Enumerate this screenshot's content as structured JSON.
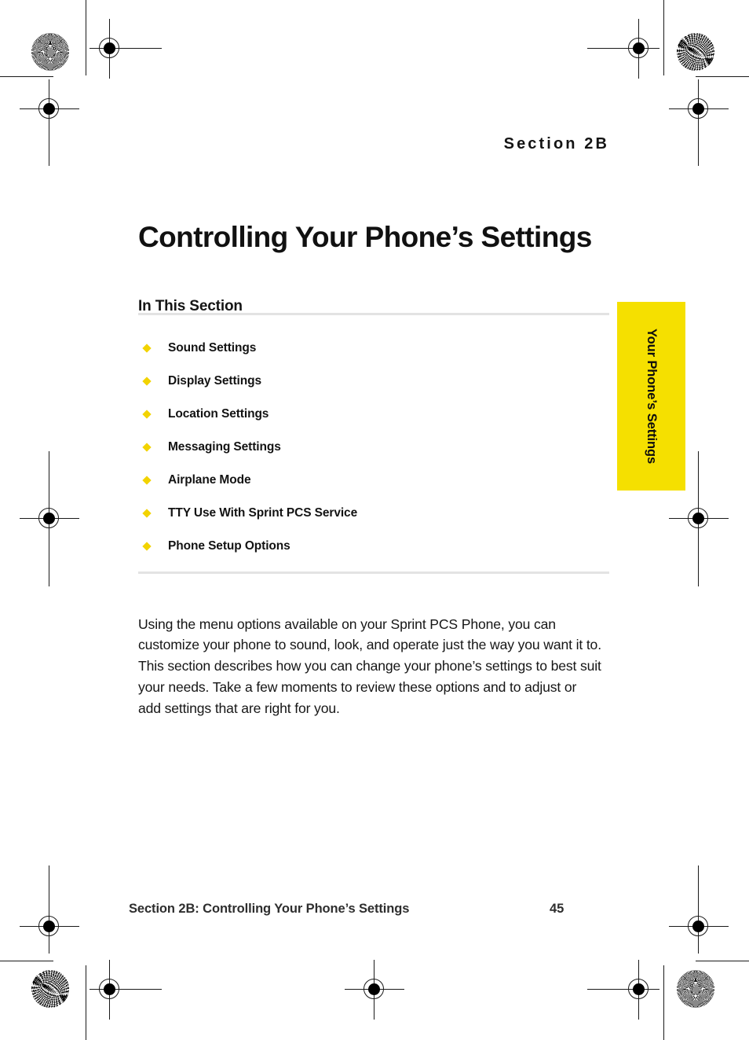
{
  "document": {
    "section_eyebrow": "Section 2B",
    "title": "Controlling Your Phone’s Settings",
    "in_this_section_heading": "In This Section",
    "toc_items": [
      {
        "label": "Sound Settings",
        "bullet": "diamond-bullet-icon"
      },
      {
        "label": "Display Settings",
        "bullet": "diamond-bullet-icon"
      },
      {
        "label": "Location Settings",
        "bullet": "diamond-bullet-icon"
      },
      {
        "label": "Messaging Settings",
        "bullet": "diamond-bullet-icon"
      },
      {
        "label": "Airplane Mode",
        "bullet": "diamond-bullet-icon"
      },
      {
        "label": "TTY Use With Sprint PCS Service",
        "bullet": "diamond-bullet-icon"
      },
      {
        "label": "Phone Setup Options",
        "bullet": "diamond-bullet-icon"
      }
    ],
    "body_paragraph": "Using the menu options available on your Sprint PCS Phone, you can customize your phone to sound, look, and operate just the way you want it to. This section describes how you can change your phone’s settings to best suit your needs. Take a few moments to review these options and to adjust or add settings that are right for you.",
    "side_tab_label": "Your Phone’s Settings",
    "footer": {
      "title": "Section 2B: Controlling Your Phone’s Settings",
      "page_number": "45"
    }
  },
  "colors": {
    "accent_yellow": "#F5E000",
    "bullet_yellow": "#F2D300",
    "rule_gray": "#E3E3E3",
    "text_black": "#111111",
    "footer_gray": "#2E2E2E",
    "mark_black": "#1A1A1A"
  },
  "print_marks": {
    "registration_target_icon": "registration-target-icon",
    "starburst_swatch_icon": "starburst-density-swatch-icon",
    "moire_swatch_icon": "moire-density-swatch-icon",
    "trim_line_icon": "trim-line-icon"
  }
}
